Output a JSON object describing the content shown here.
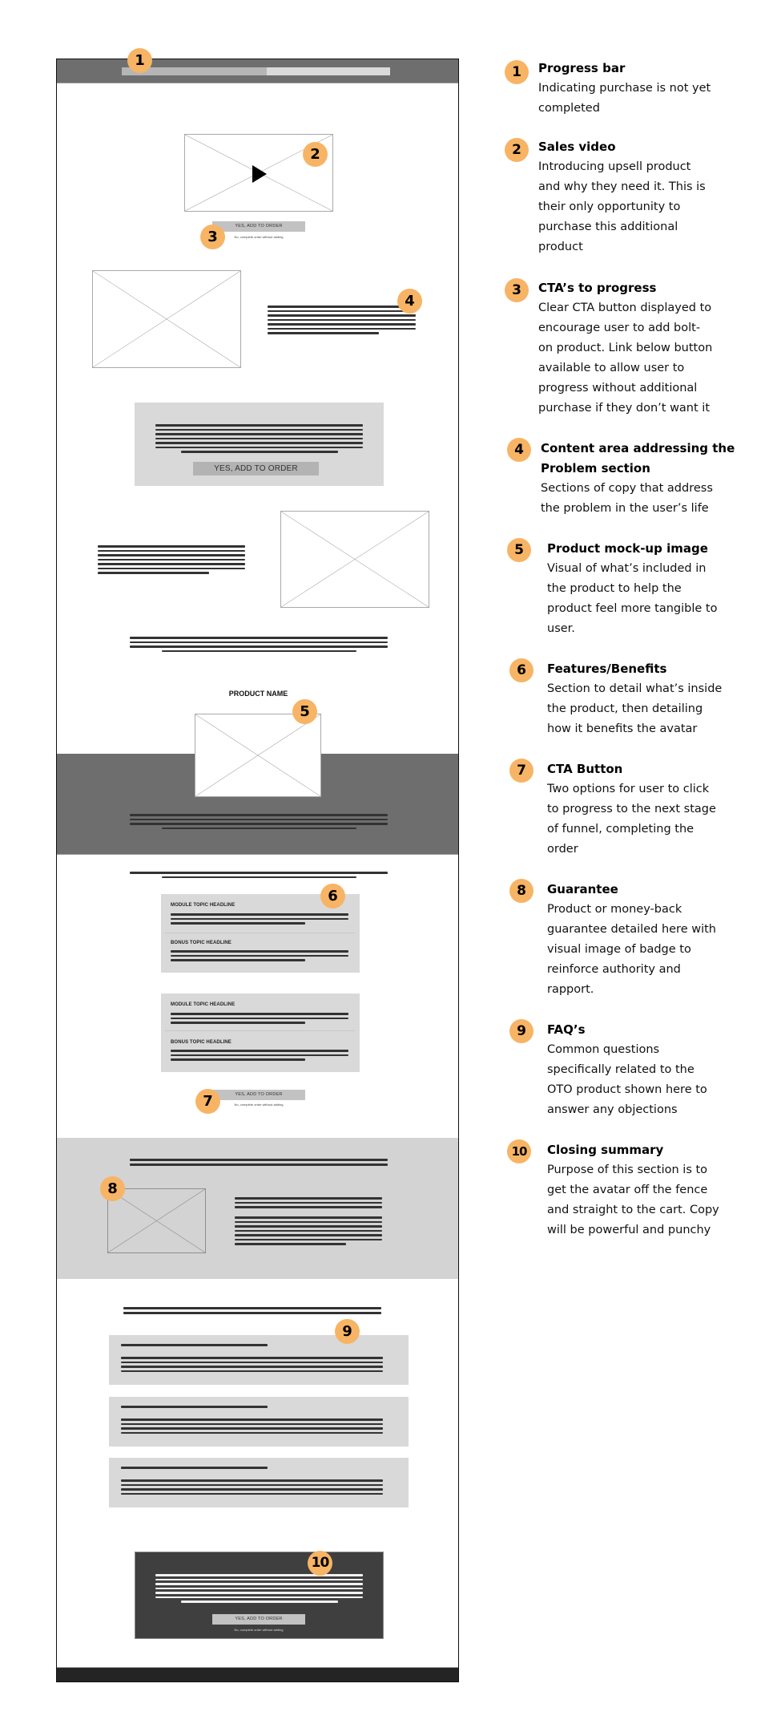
{
  "colors": {
    "badge": "#F7B465",
    "progress_band": "#6e6e6e",
    "progress_fill": "#b5b5b5",
    "progress_track": "#dadada",
    "panel_light": "#d9d9d9",
    "band_dark": "#6e6e6e",
    "band_light": "#d3d3d3",
    "closing_box": "#3f3f3f",
    "footer": "#242424"
  },
  "wireframe": {
    "progress": {
      "badge": "1",
      "fill_fraction": 0.54
    },
    "video": {
      "badge": "2",
      "icon": "play-icon"
    },
    "cta_top": {
      "badge": "3",
      "button_label": "YES, ADD TO ORDER",
      "skip_label": "No, complete order without adding"
    },
    "problem": {
      "badge": "4"
    },
    "problem_cta": {
      "button_label": "YES, ADD TO ORDER"
    },
    "product": {
      "badge": "5",
      "name": "PRODUCT NAME"
    },
    "features": {
      "badge": "6",
      "cards": [
        {
          "items": [
            {
              "headline": "MODULE TOPIC HEADLINE"
            },
            {
              "headline": "BONUS TOPIC HEADLINE"
            }
          ]
        },
        {
          "items": [
            {
              "headline": "MODULE TOPIC HEADLINE"
            },
            {
              "headline": "BONUS TOPIC HEADLINE"
            }
          ]
        }
      ]
    },
    "cta_mid": {
      "badge": "7",
      "button_label": "YES, ADD TO ORDER",
      "skip_label": "No, complete order without adding"
    },
    "guarantee": {
      "badge": "8"
    },
    "faq": {
      "badge": "9",
      "count": 3
    },
    "closing": {
      "badge": "10",
      "button_label": "YES, ADD TO ORDER",
      "skip_label": "No, complete order without adding"
    }
  },
  "legend": [
    {
      "number": "1",
      "title": "Progress bar",
      "body": [
        "Indicating purchase is not yet",
        "completed"
      ]
    },
    {
      "number": "2",
      "title": "Sales video",
      "body": [
        "Introducing upsell product",
        "and why they need it. This is",
        "their only opportunity to",
        "purchase this additional",
        "product"
      ]
    },
    {
      "number": "3",
      "title": "CTA’s to progress",
      "body": [
        "Clear CTA button displayed to",
        "encourage user to add bolt-",
        "on product. Link below button",
        "available to allow user to",
        "progress without additional",
        "purchase if they don’t want it"
      ]
    },
    {
      "number": "4",
      "title": "Content area addressing the",
      "title2": "Problem section",
      "body": [
        "Sections of copy that address",
        "the problem in the user’s life"
      ]
    },
    {
      "number": "5",
      "title": "Product mock-up image",
      "body": [
        "Visual of what’s included in",
        "the product to help the",
        "product feel more tangible to",
        "user."
      ]
    },
    {
      "number": "6",
      "title": "Features/Benefits",
      "body": [
        "Section to detail what’s inside",
        "the product, then detailing",
        "how it benefits the avatar"
      ]
    },
    {
      "number": "7",
      "title": "CTA Button",
      "body": [
        "Two options for user to click",
        "to progress to the next stage",
        "of funnel, completing the",
        "order"
      ]
    },
    {
      "number": "8",
      "title": "Guarantee",
      "body": [
        "Product or money-back",
        "guarantee detailed here with",
        "visual image of badge to",
        "reinforce authority and",
        "rapport."
      ]
    },
    {
      "number": "9",
      "title": "FAQ’s",
      "body": [
        "Common questions",
        "specifically related to the",
        "OTO product shown here to",
        "answer any objections"
      ]
    },
    {
      "number": "10",
      "title": "Closing summary",
      "body": [
        "Purpose of this section is to",
        "get the avatar off the fence",
        "and straight to the cart. Copy",
        "will be powerful and punchy"
      ]
    }
  ]
}
